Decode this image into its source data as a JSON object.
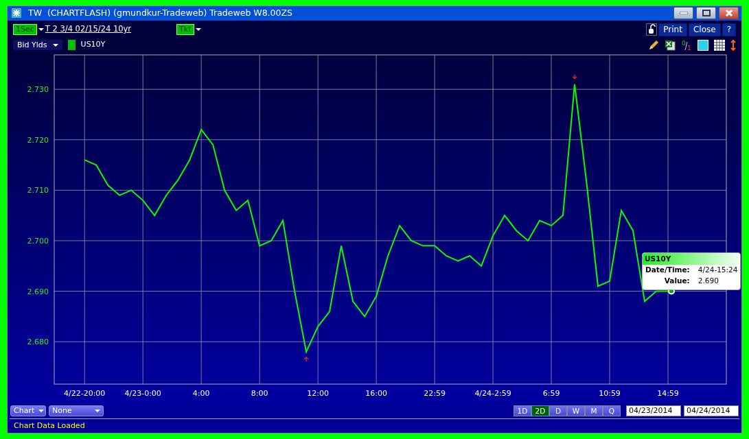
{
  "window": {
    "title": "TW  (CHARTFLASH) (gmundkur-Tradeweb) Tradeweb W8.00ZS"
  },
  "toolbar": {
    "interval": "1Sec",
    "instrument": "T  2 3/4 02/15/24 10yr",
    "ticket": "Tkt",
    "buttons": [
      "Print",
      "Close",
      "?"
    ]
  },
  "series_selector": {
    "value": "Bid Ylds",
    "legend": [
      {
        "name": "US10Y",
        "color": "#00c000"
      }
    ]
  },
  "fraction_icon": {
    "numerator": "0",
    "denominator": "1"
  },
  "chart_data": {
    "type": "line",
    "grid": true,
    "ylim": [
      2.6716,
      2.7364
    ],
    "categories": [
      "4/22-20:00",
      null,
      null,
      null,
      null,
      "4/23-0:00",
      null,
      null,
      null,
      null,
      "4:00",
      null,
      null,
      null,
      null,
      "8:00",
      null,
      null,
      null,
      null,
      "12:00",
      null,
      null,
      null,
      null,
      "16:00",
      null,
      null,
      null,
      null,
      "22:59",
      null,
      null,
      null,
      null,
      "4/24-2:59",
      null,
      null,
      null,
      null,
      "6:59",
      null,
      null,
      null,
      null,
      "10:59",
      null,
      null,
      null,
      null,
      "14:59"
    ],
    "yticks": [
      {
        "value": 2.68,
        "label": "2.680"
      },
      {
        "value": 2.69,
        "label": "2.690"
      },
      {
        "value": 2.7,
        "label": "2.700"
      },
      {
        "value": 2.71,
        "label": "2.710"
      },
      {
        "value": 2.72,
        "label": "2.720"
      },
      {
        "value": 2.73,
        "label": "2.730"
      }
    ],
    "series": [
      {
        "name": "US10Y",
        "color": "#00ff00",
        "values": [
          2.716,
          2.715,
          2.711,
          2.709,
          2.71,
          2.708,
          2.705,
          2.709,
          2.712,
          2.716,
          2.722,
          2.719,
          2.71,
          2.706,
          2.708,
          2.699,
          2.7,
          2.704,
          2.69,
          2.678,
          2.683,
          2.686,
          2.699,
          2.688,
          2.685,
          2.689,
          2.697,
          2.703,
          2.7,
          2.699,
          2.699,
          2.697,
          2.696,
          2.697,
          2.695,
          2.701,
          2.705,
          2.702,
          2.7,
          2.704,
          2.703,
          2.705,
          2.731,
          2.712,
          2.691,
          2.692,
          2.706,
          2.702,
          2.688,
          2.69,
          2.69
        ]
      }
    ]
  },
  "tooltip": {
    "rows": [
      {
        "label": "Date/Time:",
        "value": "4/24-15:24"
      },
      {
        "label": "Value:",
        "value": "2.690"
      }
    ]
  },
  "bottom_bar": {
    "chart_type": "Chart",
    "overlay": "None",
    "ranges": [
      {
        "label": "1D",
        "selected": false
      },
      {
        "label": "2D",
        "selected": true
      },
      {
        "label": "D",
        "selected": false
      },
      {
        "label": "W",
        "selected": false
      },
      {
        "label": "M",
        "selected": false
      },
      {
        "label": "Q",
        "selected": false
      }
    ],
    "start_date": "04/23/2014",
    "end_date": "04/24/2014"
  },
  "status_bar": {
    "text": "Chart Data Loaded"
  }
}
